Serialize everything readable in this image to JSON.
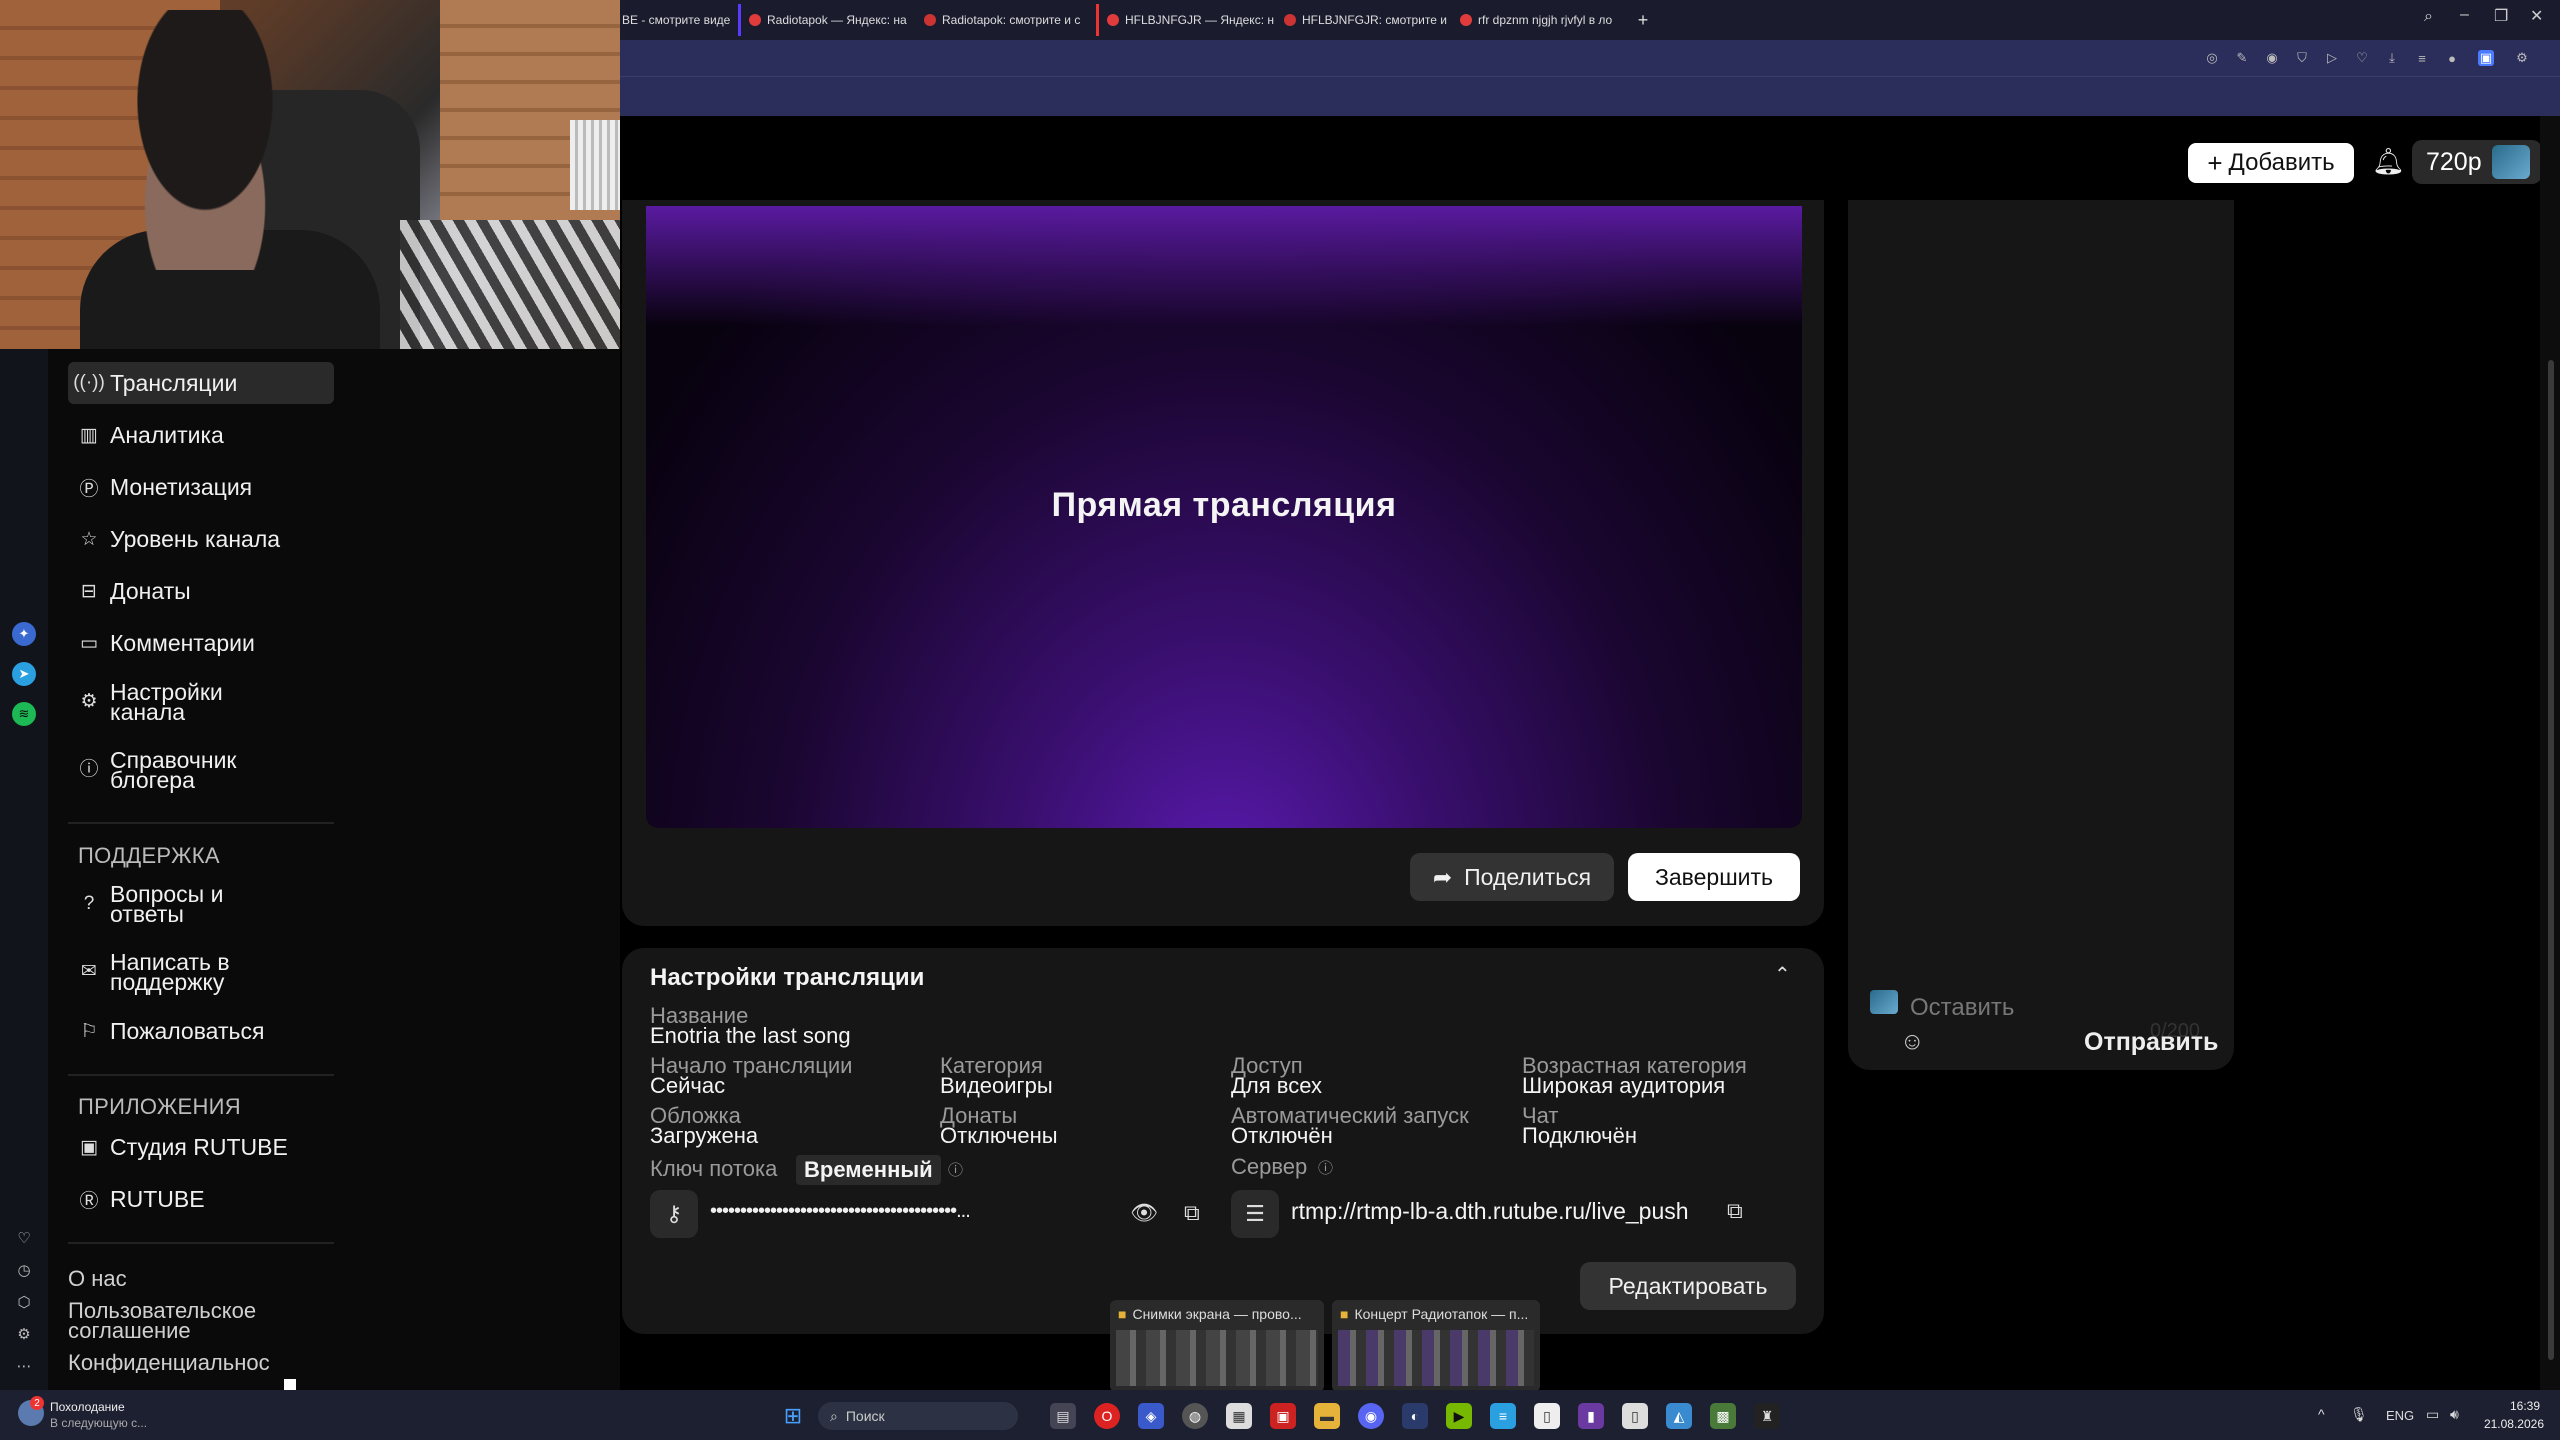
{
  "browser": {
    "tabs": [
      {
        "label": "BE - смотрите виде"
      },
      {
        "label": "Radiotapok — Яндекс: на"
      },
      {
        "label": "Radiotapok: смотрите и с"
      },
      {
        "label": "HFLBJNFGJR — Яндекс: н"
      },
      {
        "label": "HFLBJNFGJR: смотрите и"
      },
      {
        "label": "rfr dpznm njgjh rjvfyl в ло"
      }
    ],
    "new_tab": "+"
  },
  "header": {
    "add_label": "Добавить",
    "quality_label": "720p"
  },
  "sidebar": {
    "items": [
      {
        "label": "Трансляции",
        "icon": "broadcast-icon"
      },
      {
        "label": "Аналитика",
        "icon": "analytics-icon"
      },
      {
        "label": "Монетизация",
        "icon": "ruble-icon"
      },
      {
        "label": "Уровень канала",
        "icon": "star-icon"
      },
      {
        "label": "Донаты",
        "icon": "gift-icon"
      },
      {
        "label": "Комментарии",
        "icon": "comment-icon"
      },
      {
        "label": "Настройки канала",
        "icon": "gear-icon"
      },
      {
        "label": "Справочник блогера",
        "icon": "info-icon"
      }
    ],
    "support_heading": "ПОДДЕРЖКА",
    "support_items": [
      {
        "label": "Вопросы и ответы",
        "icon": "question-icon"
      },
      {
        "label": "Написать в поддержку",
        "icon": "mail-icon"
      },
      {
        "label": "Пожаловаться",
        "icon": "flag-icon"
      }
    ],
    "apps_heading": "ПРИЛОЖЕНИЯ",
    "apps_items": [
      {
        "label": "Студия RUTUBE",
        "icon": "studio-icon"
      },
      {
        "label": "RUTUBE",
        "icon": "rutube-icon"
      }
    ],
    "footer_links": [
      "О нас",
      "Пользовательское соглашение",
      "Конфиденциальнос"
    ]
  },
  "player": {
    "title": "Прямая трансляция",
    "share_label": "Поделиться",
    "finish_label": "Завершить"
  },
  "chat": {
    "placeholder": "Оставить",
    "counter": "0/200",
    "send_label": "Отправить"
  },
  "settings": {
    "title": "Настройки трансляции",
    "name_label": "Название",
    "name_value": "Enotria the last song",
    "start_label": "Начало трансляции",
    "start_value": "Сейчас",
    "category_label": "Категория",
    "category_value": "Видеоигры",
    "access_label": "Доступ",
    "access_value": "Для всех",
    "age_label": "Возрастная категория",
    "age_value": "Широкая аудитория",
    "cover_label": "Обложка",
    "cover_value": "Загружена",
    "donats_label": "Донаты",
    "donats_value": "Отключены",
    "autostart_label": "Автоматический запуск",
    "autostart_value": "Отключён",
    "chat_label": "Чат",
    "chat_value": "Подключён",
    "key_label": "Ключ потока",
    "key_badge": "Временный",
    "key_value": "•••••••••••••••••••••••••••••••••••••••••...",
    "server_label": "Сервер",
    "server_value": "rtmp://rtmp-lb-a.dth.rutube.ru/live_push",
    "edit_label": "Редактировать"
  },
  "thumbnails": [
    {
      "label": "Снимки экрана — прово..."
    },
    {
      "label": "Концерт Радиотапок — п..."
    }
  ],
  "taskbar": {
    "weather_title": "Похолодание",
    "weather_sub": "В следующую с...",
    "weather_badge": "2",
    "search_placeholder": "Поиск",
    "lang": "ENG",
    "time": "16:39",
    "date": "21.08.2026"
  },
  "colors": {
    "accent_purple": "#5a1ab0",
    "card_bg": "#161616",
    "toolbar_bg": "#2b2e5a"
  }
}
